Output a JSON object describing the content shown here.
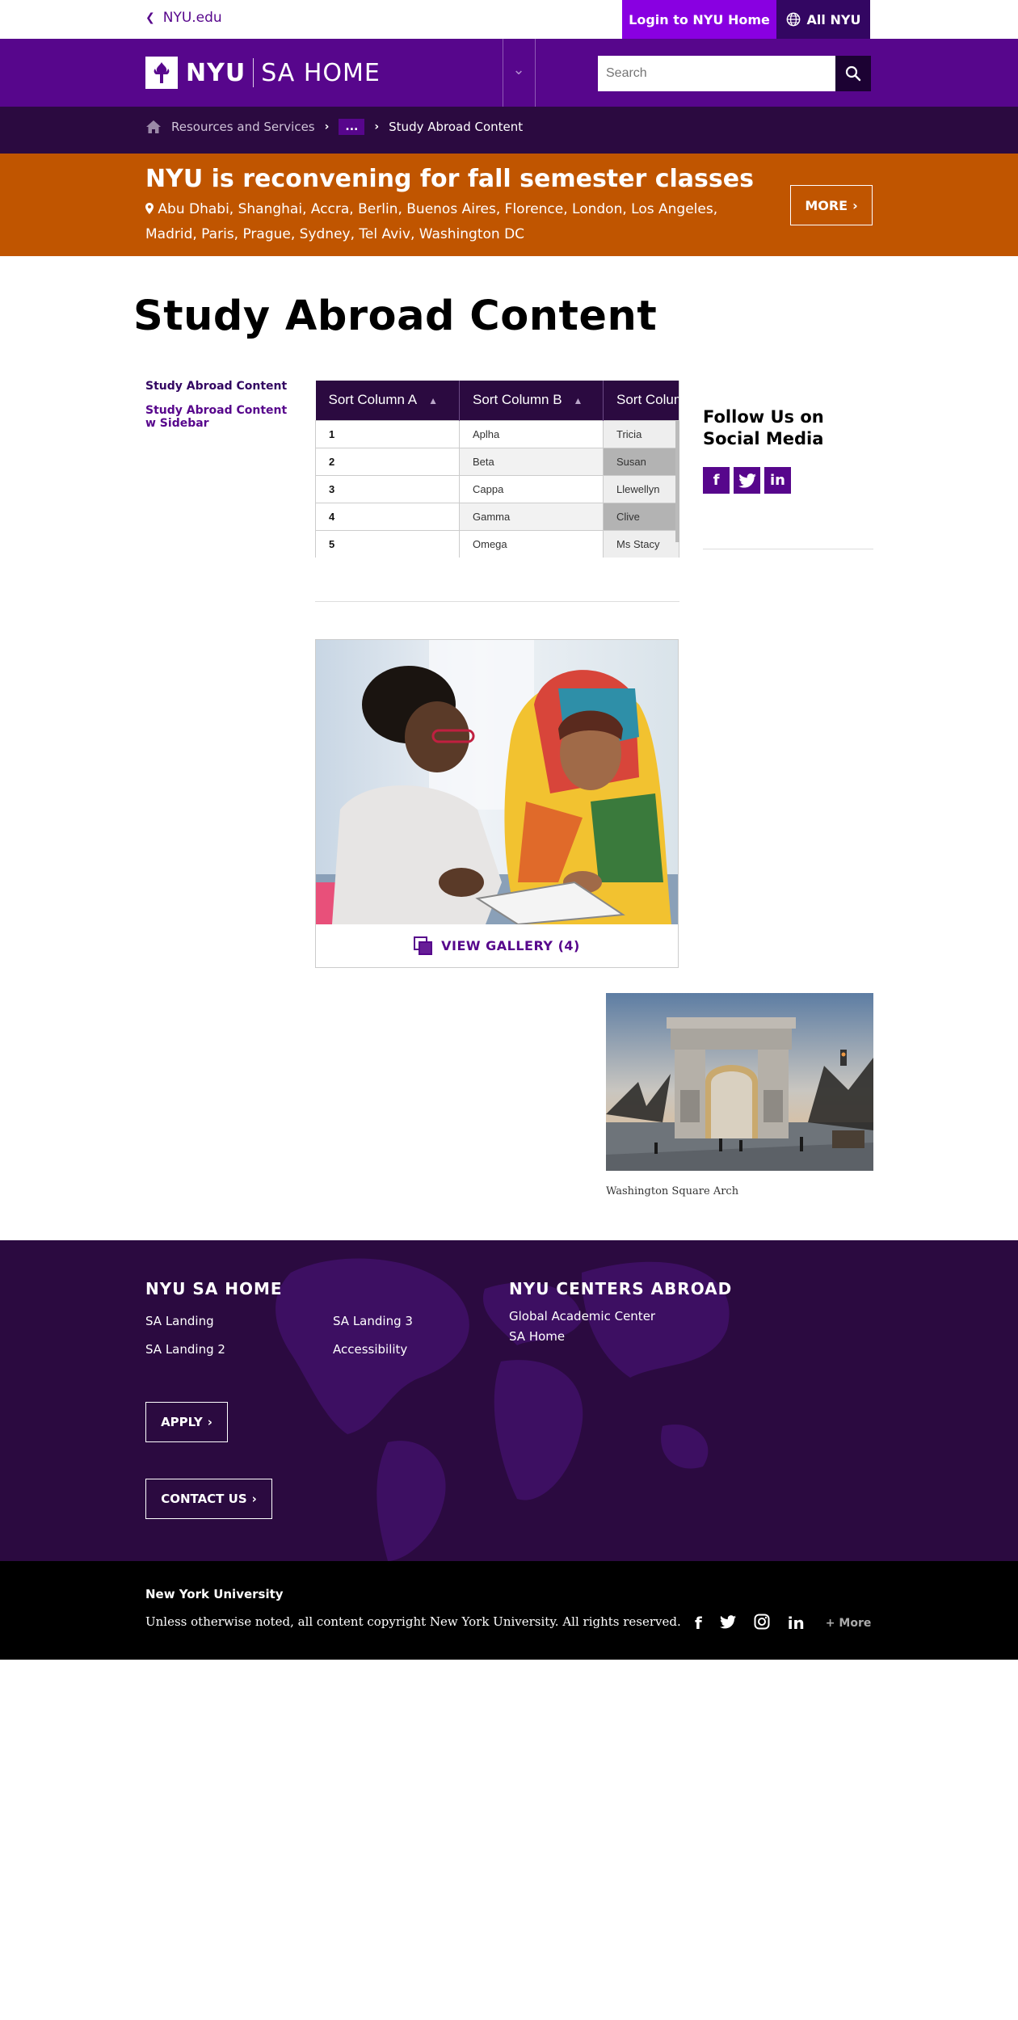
{
  "topbar": {
    "nyu_link": "NYU.edu",
    "login": "Login to NYU Home",
    "all_nyu": "All NYU"
  },
  "header": {
    "logo_nyu": "NYU",
    "logo_site": "SA HOME",
    "search_placeholder": "Search"
  },
  "breadcrumb": {
    "items": [
      "Resources and Services",
      "...",
      "Study Abroad Content"
    ]
  },
  "alert": {
    "title": "NYU is reconvening for fall semester classes",
    "locations": "Abu Dhabi, Shanghai, Accra, Berlin, Buenos Aires, Florence, London, Los Angeles, Madrid, Paris, Prague, Sydney, Tel Aviv, Washington DC",
    "more": "MORE"
  },
  "page": {
    "title": "Study Abroad Content"
  },
  "leftnav": {
    "items": [
      "Study Abroad Content",
      "Study Abroad Content w Sidebar"
    ]
  },
  "table": {
    "headers": [
      "Sort Column A",
      "Sort Column B",
      "Sort Column C"
    ],
    "rows": [
      [
        "1",
        "Aplha",
        "Tricia"
      ],
      [
        "2",
        "Beta",
        "Susan"
      ],
      [
        "3",
        "Cappa",
        "Llewellyn"
      ],
      [
        "4",
        "Gamma",
        "Clive"
      ],
      [
        "5",
        "Omega",
        "Ms Stacy"
      ]
    ]
  },
  "sidebar": {
    "follow_title": "Follow Us on Social Media",
    "icons": [
      "facebook-icon",
      "twitter-icon",
      "linkedin-icon"
    ]
  },
  "gallery": {
    "button": "VIEW GALLERY (4)"
  },
  "arch": {
    "caption": "Washington Square Arch"
  },
  "footer": {
    "col1_title": "NYU SA HOME",
    "col1_links": [
      "SA Landing",
      "SA Landing 2",
      "SA Landing 3",
      "Accessibility"
    ],
    "col2_title": "NYU CENTERS ABROAD",
    "col2_links": [
      "Global Academic Center",
      "SA Home"
    ],
    "apply": "APPLY",
    "contact": "CONTACT US"
  },
  "bottom": {
    "title": "New York University",
    "copyright": "Unless otherwise noted, all content copyright New York University. All rights reserved.",
    "more": "+ More"
  },
  "colors": {
    "purple": "#57068c",
    "bright_purple": "#8900e1",
    "dark_purple": "#2b0a40",
    "alert_orange": "#c05500"
  }
}
